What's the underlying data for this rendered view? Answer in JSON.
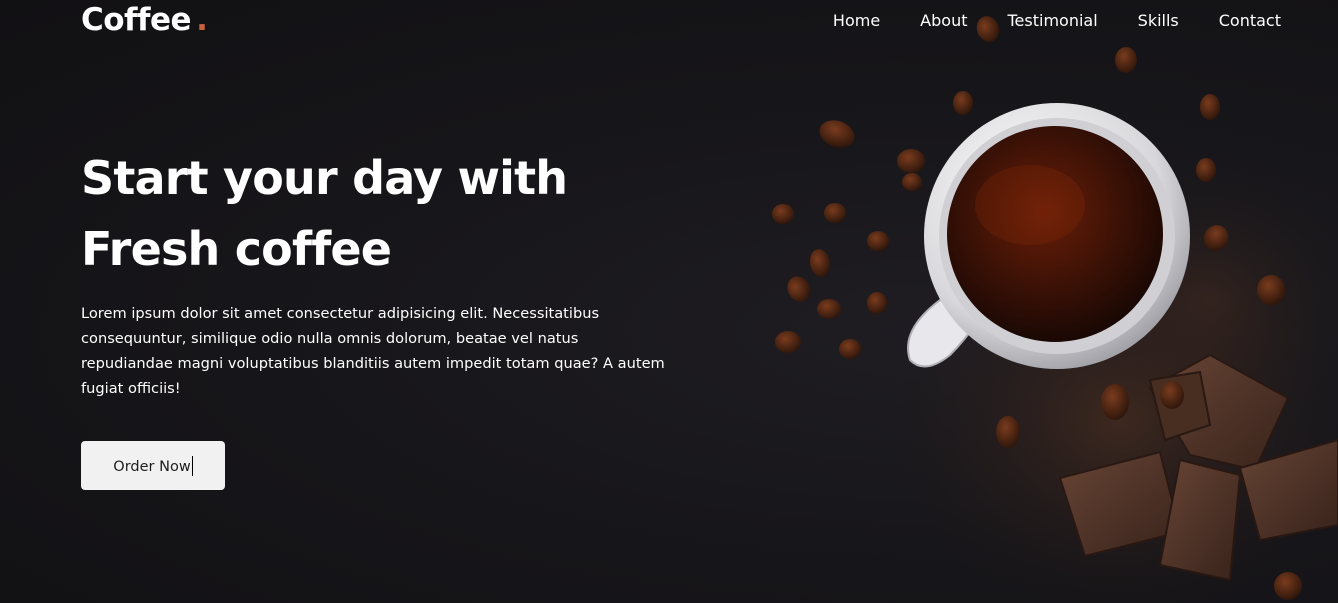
{
  "header": {
    "logo_text": "Coffee",
    "logo_dot": ".",
    "nav": [
      {
        "label": "Home"
      },
      {
        "label": "About"
      },
      {
        "label": "Testimonial"
      },
      {
        "label": "Skills"
      },
      {
        "label": "Contact"
      }
    ]
  },
  "hero": {
    "title_line1": "Start your day with",
    "title_line2": "Fresh coffee",
    "description": "Lorem ipsum dolor sit amet consectetur adipisicing elit. Necessitatibus consequuntur, similique odio nulla omnis dolorum, beatae vel natus repudiandae magni voluptatibus blanditiis autem impedit totam quae? A autem fugiat officiis!",
    "cta_label": "Order Now"
  },
  "colors": {
    "background": "#141317",
    "text": "#ffffff",
    "accent": "#c8613a",
    "button_bg": "#f1f1f1"
  }
}
